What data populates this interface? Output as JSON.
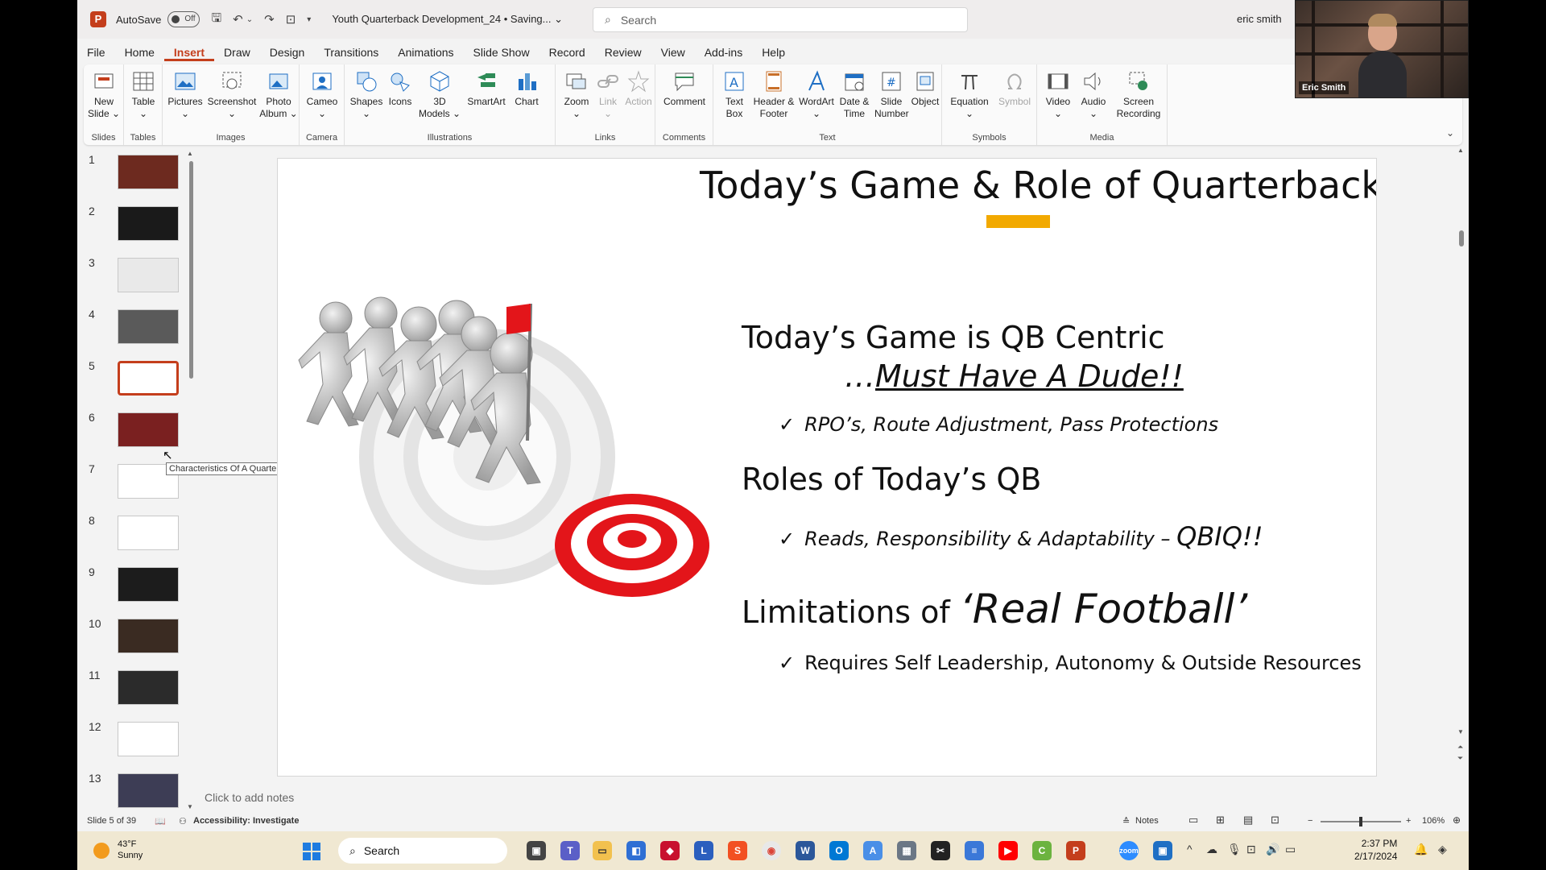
{
  "titlebar": {
    "autosave_label": "AutoSave",
    "autosave_state": "Off",
    "doc_title": "Youth Quarterback Development_24 • Saving... ⌄",
    "search_placeholder": "Search",
    "user_name": "eric smith"
  },
  "webcam": {
    "name": "Eric Smith"
  },
  "menu": {
    "tabs": [
      "File",
      "Home",
      "Insert",
      "Draw",
      "Design",
      "Transitions",
      "Animations",
      "Slide Show",
      "Record",
      "Review",
      "View",
      "Add-ins",
      "Help"
    ],
    "active": "Insert"
  },
  "ribbon": {
    "groups": {
      "slides": "Slides",
      "tables": "Tables",
      "images": "Images",
      "camera": "Camera",
      "illustrations": "Illustrations",
      "links": "Links",
      "comments": "Comments",
      "text": "Text",
      "symbols": "Symbols",
      "media": "Media"
    },
    "buttons": {
      "new_slide": "New Slide ⌄",
      "table": "Table ⌄",
      "pictures": "Pictures ⌄",
      "screenshot": "Screenshot ⌄",
      "photo_album": "Photo Album ⌄",
      "cameo": "Cameo ⌄",
      "shapes": "Shapes ⌄",
      "icons": "Icons",
      "models3d": "3D Models ⌄",
      "smartart": "SmartArt",
      "chart": "Chart",
      "zoom": "Zoom ⌄",
      "link": "Link ⌄",
      "action": "Action",
      "comment": "Comment",
      "text_box": "Text Box",
      "header_footer": "Header & Footer",
      "wordart": "WordArt ⌄",
      "date_time": "Date & Time",
      "slide_number": "Slide Number",
      "object": "Object",
      "equation": "Equation ⌄",
      "symbol": "Symbol",
      "video": "Video ⌄",
      "audio": "Audio ⌄",
      "screen_recording": "Screen Recording"
    }
  },
  "thumbnails": {
    "numbers": [
      "1",
      "2",
      "3",
      "4",
      "5",
      "6",
      "7",
      "8",
      "9",
      "10",
      "11",
      "12",
      "13"
    ],
    "selected": "5",
    "tooltip": "Characteristics Of A Quarterback"
  },
  "slide": {
    "title": "Today’s Game & Role of Quarterback",
    "heading1": "Today’s Game is QB Centric",
    "heading1_sub_prefix": "…",
    "heading1_sub": "Must Have A Dude!!",
    "bullet1": "RPO’s, Route Adjustment, Pass Protections",
    "heading2": "Roles of Today’s QB",
    "bullet2": "Reads, Responsibility & Adaptability – ",
    "bullet2_emph": "QBIQ!!",
    "heading3": "Limitations of ",
    "heading3_emph": "‘Real Football’",
    "bullet3": "Requires Self Leadership, Autonomy & Outside Resources",
    "accent_color": "#f2a900"
  },
  "notes": {
    "placeholder": "Click to add notes"
  },
  "statusbar": {
    "slide_counter": "Slide 5 of 39",
    "accessibility": "Accessibility: Investigate",
    "notes": "Notes",
    "zoom": "106%"
  },
  "taskbar": {
    "temperature": "43°F",
    "condition": "Sunny",
    "search": "Search",
    "time": "2:37 PM",
    "date": "2/17/2024"
  },
  "colors": {
    "brand": "#c43e1c",
    "target_red": "#e3151a"
  }
}
